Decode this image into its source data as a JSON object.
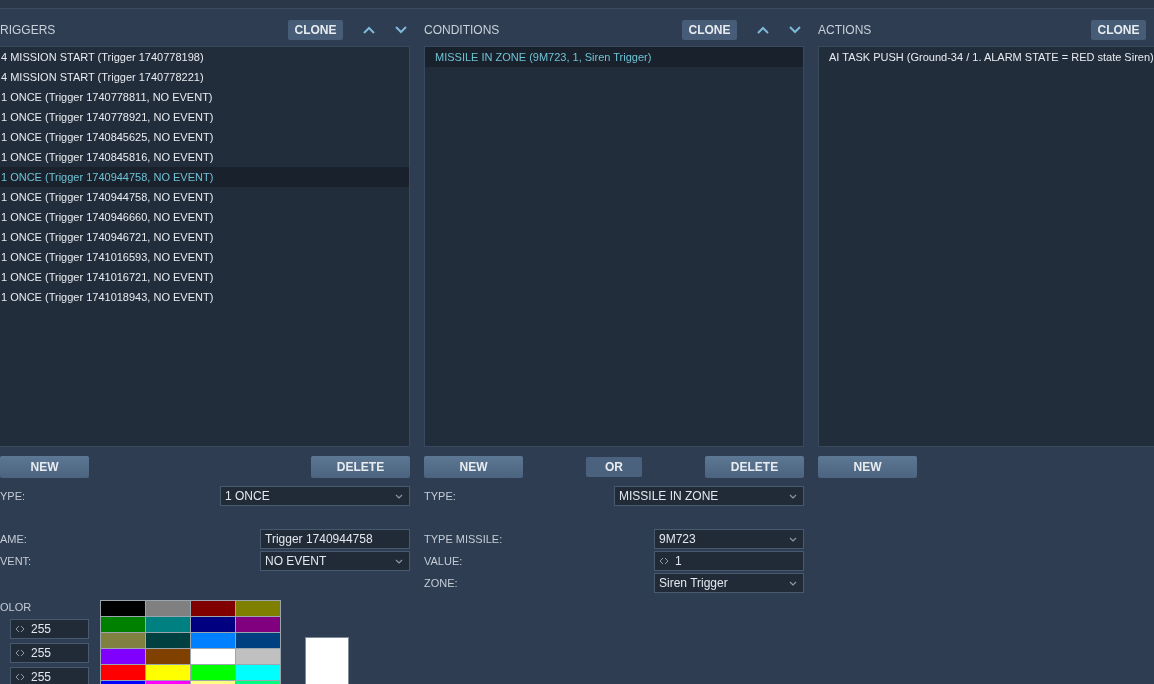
{
  "triggers": {
    "title": "RIGGERS",
    "clone": "CLONE",
    "items": [
      {
        "label": "4 MISSION START (Trigger 1740778198)",
        "selected": false
      },
      {
        "label": "4 MISSION START (Trigger 1740778221)",
        "selected": false
      },
      {
        "label": "1 ONCE (Trigger 1740778811, NO EVENT)",
        "selected": false
      },
      {
        "label": "1 ONCE (Trigger 1740778921, NO EVENT)",
        "selected": false
      },
      {
        "label": "1 ONCE (Trigger 1740845625, NO EVENT)",
        "selected": false
      },
      {
        "label": "1 ONCE (Trigger 1740845816, NO EVENT)",
        "selected": false
      },
      {
        "label": "1 ONCE (Trigger 1740944758, NO EVENT)",
        "selected": true
      },
      {
        "label": "1 ONCE (Trigger 1740944758, NO EVENT)",
        "selected": false
      },
      {
        "label": "1 ONCE (Trigger 1740946660, NO EVENT)",
        "selected": false
      },
      {
        "label": "1 ONCE (Trigger 1740946721, NO EVENT)",
        "selected": false
      },
      {
        "label": "1 ONCE (Trigger 1741016593, NO EVENT)",
        "selected": false
      },
      {
        "label": "1 ONCE (Trigger 1741016721, NO EVENT)",
        "selected": false
      },
      {
        "label": "1 ONCE (Trigger 1741018943, NO EVENT)",
        "selected": false
      }
    ],
    "buttons": [
      "NEW",
      "DELETE"
    ],
    "type": {
      "label": "YPE:",
      "value": "1 ONCE"
    },
    "fields": [
      {
        "kind": "input",
        "label": "AME:",
        "value": "Trigger 1740944758"
      },
      {
        "kind": "select",
        "label": "VENT:",
        "value": "NO EVENT"
      }
    ],
    "color": {
      "label": "OLOR",
      "channels": [
        "255",
        "255",
        "255"
      ],
      "swatches": [
        {
          "color": "#000000"
        },
        {
          "color": "#808080"
        },
        {
          "color": "#800000"
        },
        {
          "color": "#808000"
        },
        {
          "color": "#008000"
        },
        {
          "color": "#008080"
        },
        {
          "color": "#000080"
        },
        {
          "color": "#800080"
        },
        {
          "color": "#808040"
        },
        {
          "color": "#004040"
        },
        {
          "color": "#0080ff"
        },
        {
          "color": "#004080"
        },
        {
          "color": "#8000ff"
        },
        {
          "color": "#804000"
        },
        {
          "color": "#ffffff"
        },
        {
          "color": "#c0c0c0"
        },
        {
          "color": "#ff0000"
        },
        {
          "color": "#ffff00"
        },
        {
          "color": "#00ff00"
        },
        {
          "color": "#00ffff"
        },
        {
          "color": "#0000ff"
        },
        {
          "color": "#ff00ff"
        },
        {
          "color": "#ffff80"
        },
        {
          "color": "#00ff80"
        }
      ]
    }
  },
  "conditions": {
    "title": "CONDITIONS",
    "clone": "CLONE",
    "items": [
      {
        "label": "MISSILE IN ZONE (9M723, 1, Siren Trigger)",
        "selected": true
      }
    ],
    "buttons": [
      "NEW",
      "OR",
      "DELETE"
    ],
    "type": {
      "label": "TYPE:",
      "value": "MISSILE IN ZONE"
    },
    "fields": [
      {
        "kind": "select",
        "label": "TYPE MISSILE:",
        "value": "9M723"
      },
      {
        "kind": "spinner",
        "label": "VALUE:",
        "value": "1"
      },
      {
        "kind": "select",
        "label": "ZONE:",
        "value": "Siren Trigger"
      }
    ]
  },
  "actions": {
    "title": "ACTIONS",
    "clone": "CLONE",
    "items": [
      {
        "label": "AI TASK PUSH (Ground-34 / 1. ALARM STATE = RED state Siren)",
        "selected": false
      }
    ],
    "buttons": [
      "NEW"
    ]
  }
}
